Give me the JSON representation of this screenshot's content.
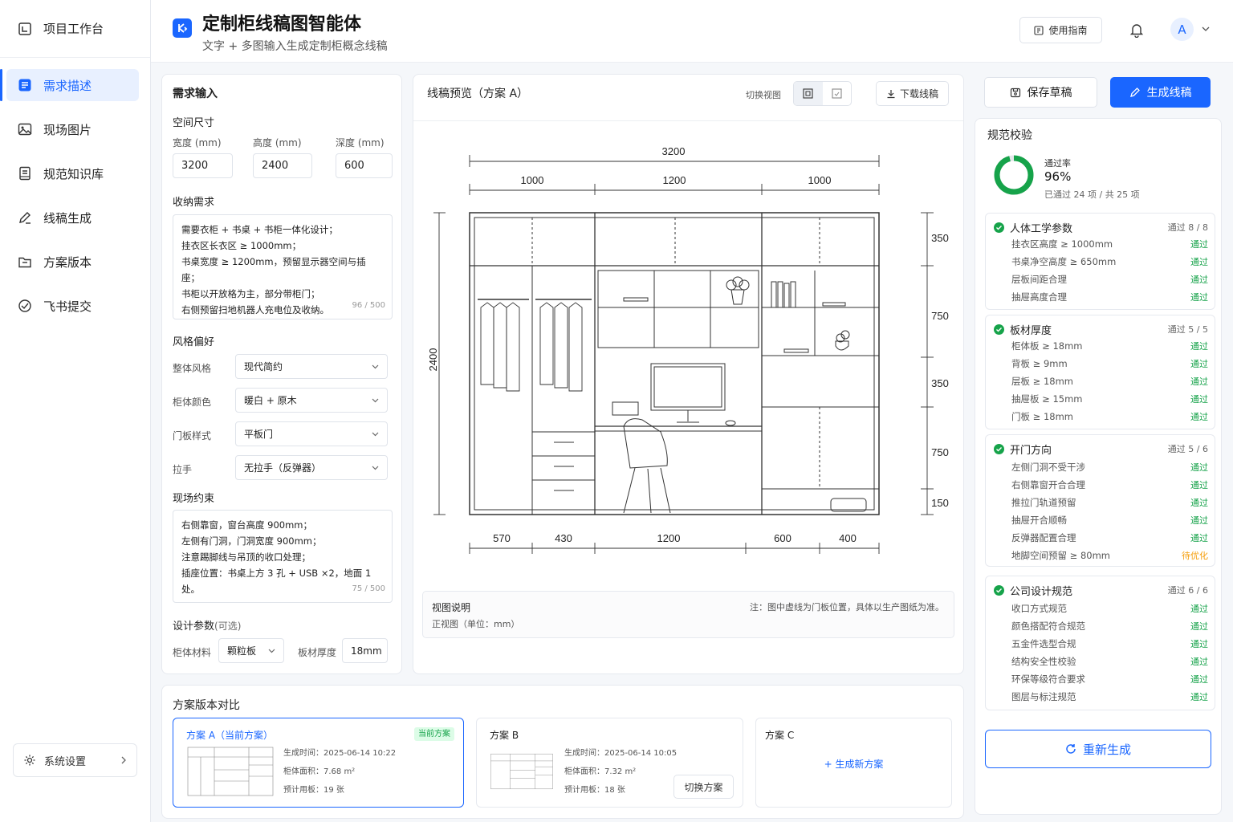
{
  "sidebar": {
    "workspace": "项目工作台",
    "items": [
      {
        "label": "需求描述",
        "icon": "list-icon",
        "active": true
      },
      {
        "label": "现场图片",
        "icon": "image-icon"
      },
      {
        "label": "规范知识库",
        "icon": "book-icon"
      },
      {
        "label": "线稿生成",
        "icon": "pencil-icon"
      },
      {
        "label": "方案版本",
        "icon": "folder-icon"
      },
      {
        "label": "飞书提交",
        "icon": "send-icon"
      }
    ],
    "settings": "系统设置"
  },
  "header": {
    "title": "定制柜线稿图智能体",
    "subtitle": "文字 + 多图输入生成定制柜概念线稿",
    "guide": "使用指南",
    "avatar": "A"
  },
  "input": {
    "title": "需求输入",
    "size_title": "空间尺寸",
    "width_label": "宽度 (mm)",
    "width": "3200",
    "height_label": "高度 (mm)",
    "height": "2400",
    "depth_label": "深度 (mm)",
    "depth": "600",
    "storage_title": "收纳需求",
    "storage_lines": [
      "需要衣柜 + 书桌 + 书柜一体化设计；",
      "挂衣区长衣区 ≥ 1000mm；",
      "书桌宽度 ≥ 1200mm，预留显示器空间与插座；",
      "书柜以开放格为主，部分带柜门；",
      "右侧预留扫地机器人充电位及收纳。"
    ],
    "storage_count": "96 / 500",
    "style_title": "风格偏好",
    "style_rows": [
      {
        "label": "整体风格",
        "value": "现代简约"
      },
      {
        "label": "柜体颜色",
        "value": "暖白 + 原木"
      },
      {
        "label": "门板样式",
        "value": "平板门"
      },
      {
        "label": "拉手",
        "value": "无拉手（反弹器）"
      }
    ],
    "site_title": "现场约束",
    "site_lines": [
      "右侧靠窗，窗台高度 900mm；",
      "左侧有门洞，门洞宽度 900mm；",
      "注意踢脚线与吊顶的收口处理；",
      "插座位置：书桌上方 3 孔 + USB ×2，地面 1 处。"
    ],
    "site_count": "75 / 500",
    "design_title": "设计参数",
    "design_optional": "(可选)",
    "material_label": "柜体材料",
    "material": "颗粒板",
    "thickness_label": "板材厚度",
    "thickness": "18mm"
  },
  "preview": {
    "title": "线稿预览（方案 A）",
    "switch_view": "切换视图",
    "download": "下载线稿",
    "note_title": "视图说明",
    "note_sub": "正视图（单位：mm）",
    "note_right": "注：图中虚线为门板位置，具体以生产图纸为准。"
  },
  "drawing": {
    "total_width": "3200",
    "top_dims": [
      "1000",
      "1200",
      "1000"
    ],
    "height": "2400",
    "right_dims": [
      "350",
      "750",
      "350",
      "750",
      "150"
    ],
    "bottom_dims": [
      "570",
      "430",
      "1200",
      "600",
      "400"
    ]
  },
  "actions": {
    "save": "保存草稿",
    "generate": "生成线稿",
    "regenerate": "重新生成"
  },
  "validation": {
    "title": "规范校验",
    "pass_label": "通过率",
    "rate": "96%",
    "rate_value": 0.96,
    "summary": "已通过 24 项 / 共 25 项",
    "groups": [
      {
        "name": "人体工学参数",
        "count": "通过 8 / 8",
        "rows": [
          {
            "label": "挂衣区高度 ≥ 1000mm",
            "status": "通过"
          },
          {
            "label": "书桌净空高度 ≥ 650mm",
            "status": "通过"
          },
          {
            "label": "层板间距合理",
            "status": "通过"
          },
          {
            "label": "抽屉高度合理",
            "status": "通过"
          }
        ]
      },
      {
        "name": "板材厚度",
        "count": "通过 5 / 5",
        "rows": [
          {
            "label": "柜体板 ≥ 18mm",
            "status": "通过"
          },
          {
            "label": "背板 ≥ 9mm",
            "status": "通过"
          },
          {
            "label": "层板 ≥ 18mm",
            "status": "通过"
          },
          {
            "label": "抽屉板 ≥ 15mm",
            "status": "通过"
          },
          {
            "label": "门板 ≥ 18mm",
            "status": "通过"
          }
        ]
      },
      {
        "name": "开门方向",
        "count": "通过 5 / 6",
        "rows": [
          {
            "label": "左侧门洞不受干涉",
            "status": "通过"
          },
          {
            "label": "右侧靠窗开合合理",
            "status": "通过"
          },
          {
            "label": "推拉门轨道预留",
            "status": "通过"
          },
          {
            "label": "抽屉开合顺畅",
            "status": "通过"
          },
          {
            "label": "反弹器配置合理",
            "status": "通过"
          },
          {
            "label": "地脚空间预留 ≥ 80mm",
            "status": "待优化",
            "warn": true
          }
        ]
      },
      {
        "name": "公司设计规范",
        "count": "通过 6 / 6",
        "rows": [
          {
            "label": "收口方式规范",
            "status": "通过"
          },
          {
            "label": "颜色搭配符合规范",
            "status": "通过"
          },
          {
            "label": "五金件选型合规",
            "status": "通过"
          },
          {
            "label": "结构安全性校验",
            "status": "通过"
          },
          {
            "label": "环保等级符合要求",
            "status": "通过"
          },
          {
            "label": "图层与标注规范",
            "status": "通过"
          }
        ]
      }
    ]
  },
  "versions": {
    "title": "方案版本对比",
    "plans": [
      {
        "name": "方案 A（当前方案）",
        "badge": "当前方案",
        "time": "生成时间：2025-06-14 10:22",
        "area": "柜体面积：7.68 m²",
        "boards": "预计用板：19 张"
      },
      {
        "name": "方案 B",
        "time": "生成时间：2025-06-14 10:05",
        "area": "柜体面积：7.32 m²",
        "boards": "预计用板：18 张",
        "switch": "切换方案"
      },
      {
        "name": "方案 C",
        "new": "+ 生成新方案"
      }
    ]
  },
  "colors": {
    "accent": "#1a66ff",
    "pass": "#16a34a",
    "warn": "#f59e0b"
  }
}
